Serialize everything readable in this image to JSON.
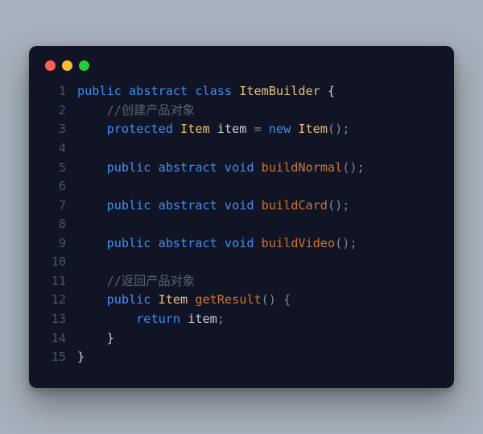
{
  "window": {
    "dots": {
      "red": "#ff5f56",
      "yellow": "#ffbd2e",
      "green": "#27c93f"
    }
  },
  "code": {
    "lines": [
      {
        "n": "1",
        "tokens": [
          {
            "t": "public",
            "c": "kw"
          },
          {
            "t": " ",
            "c": "pn"
          },
          {
            "t": "abstract",
            "c": "kw"
          },
          {
            "t": " ",
            "c": "pn"
          },
          {
            "t": "class",
            "c": "kw"
          },
          {
            "t": " ",
            "c": "pn"
          },
          {
            "t": "ItemBuilder",
            "c": "type"
          },
          {
            "t": " {",
            "c": "pn"
          }
        ]
      },
      {
        "n": "2",
        "tokens": [
          {
            "t": "    ",
            "c": "pn"
          },
          {
            "t": "//创建产品对象",
            "c": "com"
          }
        ]
      },
      {
        "n": "3",
        "tokens": [
          {
            "t": "    ",
            "c": "pn"
          },
          {
            "t": "protected",
            "c": "kw"
          },
          {
            "t": " ",
            "c": "pn"
          },
          {
            "t": "Item",
            "c": "type"
          },
          {
            "t": " ",
            "c": "pn"
          },
          {
            "t": "item",
            "c": "var"
          },
          {
            "t": " = ",
            "c": "pnlt"
          },
          {
            "t": "new",
            "c": "kw"
          },
          {
            "t": " ",
            "c": "pn"
          },
          {
            "t": "Item",
            "c": "type"
          },
          {
            "t": "();",
            "c": "pnlt"
          }
        ]
      },
      {
        "n": "4",
        "tokens": []
      },
      {
        "n": "5",
        "tokens": [
          {
            "t": "    ",
            "c": "pn"
          },
          {
            "t": "public",
            "c": "kw"
          },
          {
            "t": " ",
            "c": "pn"
          },
          {
            "t": "abstract",
            "c": "kw"
          },
          {
            "t": " ",
            "c": "pn"
          },
          {
            "t": "void",
            "c": "kw"
          },
          {
            "t": " ",
            "c": "pn"
          },
          {
            "t": "buildNormal",
            "c": "fn"
          },
          {
            "t": "();",
            "c": "pnlt"
          }
        ]
      },
      {
        "n": "6",
        "tokens": []
      },
      {
        "n": "7",
        "tokens": [
          {
            "t": "    ",
            "c": "pn"
          },
          {
            "t": "public",
            "c": "kw"
          },
          {
            "t": " ",
            "c": "pn"
          },
          {
            "t": "abstract",
            "c": "kw"
          },
          {
            "t": " ",
            "c": "pn"
          },
          {
            "t": "void",
            "c": "kw"
          },
          {
            "t": " ",
            "c": "pn"
          },
          {
            "t": "buildCard",
            "c": "fn"
          },
          {
            "t": "();",
            "c": "pnlt"
          }
        ]
      },
      {
        "n": "8",
        "tokens": []
      },
      {
        "n": "9",
        "tokens": [
          {
            "t": "    ",
            "c": "pn"
          },
          {
            "t": "public",
            "c": "kw"
          },
          {
            "t": " ",
            "c": "pn"
          },
          {
            "t": "abstract",
            "c": "kw"
          },
          {
            "t": " ",
            "c": "pn"
          },
          {
            "t": "void",
            "c": "kw"
          },
          {
            "t": " ",
            "c": "pn"
          },
          {
            "t": "buildVideo",
            "c": "fn"
          },
          {
            "t": "();",
            "c": "pnlt"
          }
        ]
      },
      {
        "n": "10",
        "tokens": []
      },
      {
        "n": "11",
        "tokens": [
          {
            "t": "    ",
            "c": "pn"
          },
          {
            "t": "//返回产品对象",
            "c": "com"
          }
        ]
      },
      {
        "n": "12",
        "tokens": [
          {
            "t": "    ",
            "c": "pn"
          },
          {
            "t": "public",
            "c": "kw"
          },
          {
            "t": " ",
            "c": "pn"
          },
          {
            "t": "Item",
            "c": "type"
          },
          {
            "t": " ",
            "c": "pn"
          },
          {
            "t": "getResult",
            "c": "fn"
          },
          {
            "t": "() {",
            "c": "pnlt"
          }
        ]
      },
      {
        "n": "13",
        "tokens": [
          {
            "t": "        ",
            "c": "pn"
          },
          {
            "t": "return",
            "c": "kw"
          },
          {
            "t": " ",
            "c": "pn"
          },
          {
            "t": "item",
            "c": "var"
          },
          {
            "t": ";",
            "c": "pnlt"
          }
        ]
      },
      {
        "n": "14",
        "tokens": [
          {
            "t": "    }",
            "c": "pn"
          }
        ]
      },
      {
        "n": "15",
        "tokens": [
          {
            "t": "}",
            "c": "pn"
          }
        ]
      }
    ]
  }
}
